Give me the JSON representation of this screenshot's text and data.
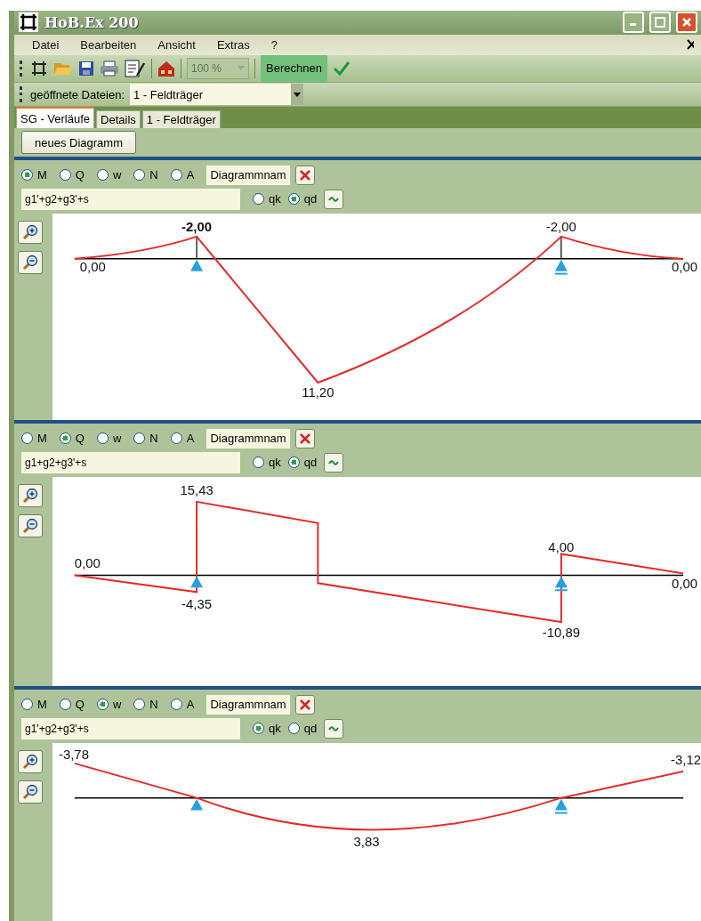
{
  "window": {
    "title": "HoB.Ex 200"
  },
  "menu": [
    {
      "label": "Datei"
    },
    {
      "label": "Bearbeiten"
    },
    {
      "label": "Ansicht"
    },
    {
      "label": "Extras"
    },
    {
      "label": "?"
    }
  ],
  "toolbar": {
    "zoom": {
      "value": "100 %",
      "disabled": true
    },
    "calculate": "Berechnen"
  },
  "open_files": {
    "label": "geöffnete Dateien:",
    "value": "1 - Feldträger"
  },
  "tabs": [
    {
      "label": "SG - Verläufe",
      "selected": true
    },
    {
      "label": "Details",
      "selected": false
    },
    {
      "label": "1 - Feldträger",
      "selected": false
    }
  ],
  "new_diagram": "neues Diagramm",
  "diagrams": [
    {
      "kind": "moment",
      "quantities": [
        {
          "label": "M",
          "selected": true
        },
        {
          "label": "Q",
          "selected": false
        },
        {
          "label": "w",
          "selected": false
        },
        {
          "label": "N",
          "selected": false
        },
        {
          "label": "A",
          "selected": false
        }
      ],
      "name_field": "Diagrammnam",
      "formula": "g1'+g2+g3'+s",
      "loads": [
        {
          "label": "qk",
          "selected": false
        },
        {
          "label": "qd",
          "selected": true
        }
      ],
      "labels": [
        {
          "text": "-2,00",
          "bold": true
        },
        {
          "text": "-2,00",
          "bold": false
        },
        {
          "text": "0,00",
          "bold": false
        },
        {
          "text": "0,00",
          "bold": false
        },
        {
          "text": "11,20",
          "bold": false
        }
      ]
    },
    {
      "kind": "shear",
      "quantities": [
        {
          "label": "M",
          "selected": false
        },
        {
          "label": "Q",
          "selected": true
        },
        {
          "label": "w",
          "selected": false
        },
        {
          "label": "N",
          "selected": false
        },
        {
          "label": "A",
          "selected": false
        }
      ],
      "name_field": "Diagrammnam",
      "formula": "g1+g2+g3'+s",
      "loads": [
        {
          "label": "qk",
          "selected": false
        },
        {
          "label": "qd",
          "selected": true
        }
      ],
      "labels": [
        {
          "text": "15,43",
          "bold": false
        },
        {
          "text": "0,00",
          "bold": false
        },
        {
          "text": "-4,35",
          "bold": false
        },
        {
          "text": "4,00",
          "bold": false
        },
        {
          "text": "0,00",
          "bold": false
        },
        {
          "text": "-10,89",
          "bold": false
        }
      ]
    },
    {
      "kind": "deflection",
      "quantities": [
        {
          "label": "M",
          "selected": false
        },
        {
          "label": "Q",
          "selected": false
        },
        {
          "label": "w",
          "selected": true
        },
        {
          "label": "N",
          "selected": false
        },
        {
          "label": "A",
          "selected": false
        }
      ],
      "name_field": "Diagrammnam",
      "formula": "g1'+g2+g3'+s",
      "loads": [
        {
          "label": "qk",
          "selected": true
        },
        {
          "label": "qd",
          "selected": false
        }
      ],
      "labels": [
        {
          "text": "-3,78",
          "bold": false
        },
        {
          "text": "-3,12",
          "bold": false
        },
        {
          "text": "3,83",
          "bold": false
        }
      ]
    }
  ]
}
